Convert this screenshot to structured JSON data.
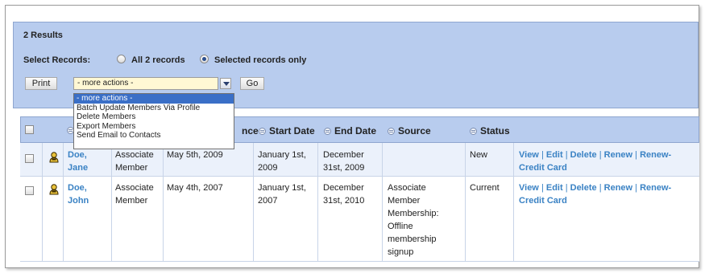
{
  "results_text": "2 Results",
  "select_records_label": "Select Records:",
  "radio_all_label": "All 2 records",
  "radio_selected_label": "Selected records only",
  "print_button": "Print",
  "actions_select_value": "- more actions -",
  "go_button": "Go",
  "dropdown_options": [
    "- more actions -",
    "Batch Update Members Via Profile",
    "Delete Members",
    "Export Members",
    "Send Email to Contacts"
  ],
  "columns": {
    "since_partial": "nce",
    "start_date": "Start Date",
    "end_date": "End Date",
    "source": "Source",
    "status": "Status"
  },
  "rows": [
    {
      "name_line1": "Doe,",
      "name_line2": "Jane",
      "type_line1": "Associate",
      "type_line2": "Member",
      "since": "May 5th, 2009",
      "start_line1": "January 1st,",
      "start_line2": "2009",
      "end_line1": "December",
      "end_line2": "31st, 2009",
      "source_lines": [],
      "status": "New"
    },
    {
      "name_line1": "Doe,",
      "name_line2": "John",
      "type_line1": "Associate",
      "type_line2": "Member",
      "since": "May 4th, 2007",
      "start_line1": "January 1st,",
      "start_line2": "2007",
      "end_line1": "December",
      "end_line2": "31st, 2010",
      "source_lines": [
        "Associate",
        "Member",
        "Membership:",
        "Offline",
        "membership",
        "signup"
      ],
      "status": "Current"
    }
  ],
  "row_actions": {
    "view": "View",
    "edit": "Edit",
    "delete": "Delete",
    "renew": "Renew",
    "renew_credit_line1": "Renew-",
    "renew_credit_line2": "Credit Card",
    "separator": "|"
  },
  "colors": {
    "panel_bg": "#b8ccee",
    "link": "#3a82c4",
    "select_bg": "#fff8d4",
    "dropdown_highlight": "#3a6fc7"
  },
  "icons": {
    "member": "person-icon",
    "sort": "sort-icon",
    "dropdown": "chevron-down-icon"
  }
}
